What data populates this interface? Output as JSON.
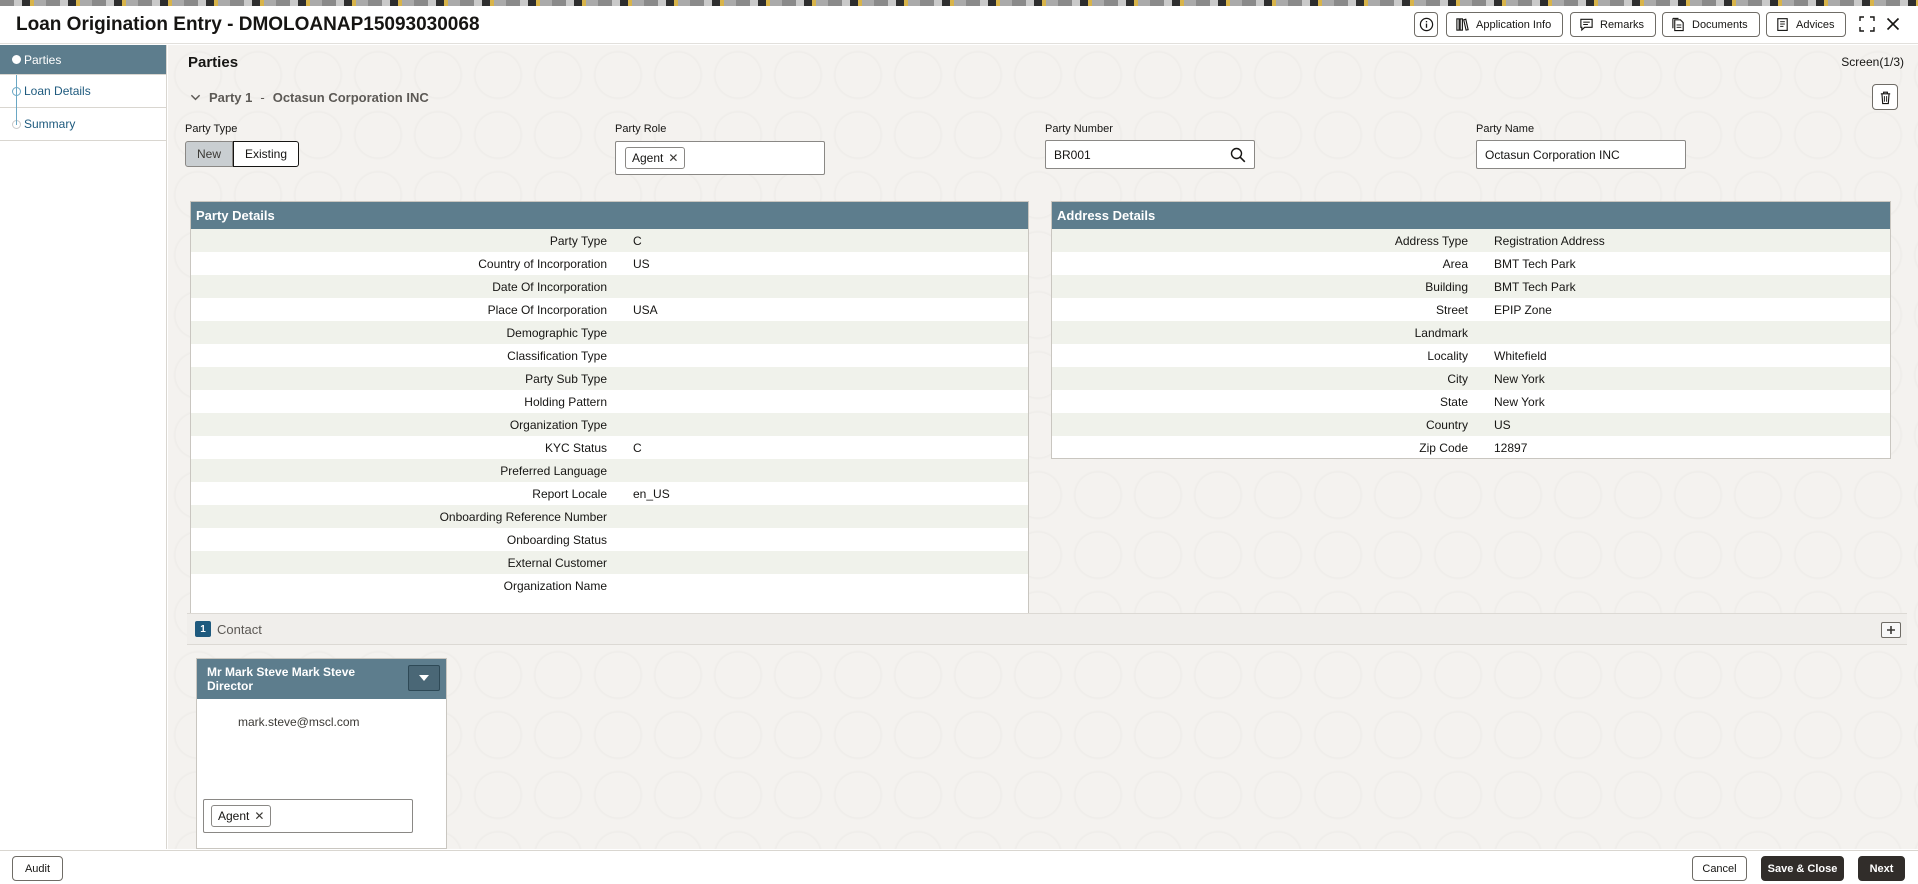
{
  "header": {
    "title": "Loan Origination Entry - DMOLOANAP15093030068",
    "buttons": {
      "application_info": "Application Info",
      "remarks": "Remarks",
      "documents": "Documents",
      "advices": "Advices"
    }
  },
  "sidebar": {
    "items": [
      {
        "label": "Parties",
        "state": "active"
      },
      {
        "label": "Loan Details",
        "state": "current"
      },
      {
        "label": "Summary",
        "state": "pending"
      }
    ]
  },
  "main": {
    "title": "Parties",
    "screen": "Screen(1/3)",
    "party_header": {
      "prefix": "Party 1",
      "separator": "-",
      "name": "Octasun Corporation INC"
    },
    "fields": {
      "party_type_label": "Party Type",
      "party_type_options": [
        "New",
        "Existing"
      ],
      "party_role_label": "Party Role",
      "party_role_chip": "Agent",
      "party_number_label": "Party Number",
      "party_number_value": "BR001",
      "party_name_label": "Party Name",
      "party_name_value": "Octasun Corporation INC"
    }
  },
  "party_details": {
    "title": "Party Details",
    "rows": [
      {
        "label": "Party Type",
        "value": "C"
      },
      {
        "label": "Country of Incorporation",
        "value": "US"
      },
      {
        "label": "Date Of Incorporation",
        "value": ""
      },
      {
        "label": "Place Of Incorporation",
        "value": "USA"
      },
      {
        "label": "Demographic Type",
        "value": ""
      },
      {
        "label": "Classification Type",
        "value": ""
      },
      {
        "label": "Party Sub Type",
        "value": ""
      },
      {
        "label": "Holding Pattern",
        "value": ""
      },
      {
        "label": "Organization Type",
        "value": ""
      },
      {
        "label": "KYC Status",
        "value": "C"
      },
      {
        "label": "Preferred Language",
        "value": ""
      },
      {
        "label": "Report Locale",
        "value": "en_US"
      },
      {
        "label": "Onboarding Reference Number",
        "value": ""
      },
      {
        "label": "Onboarding Status",
        "value": ""
      },
      {
        "label": "External Customer",
        "value": ""
      },
      {
        "label": "Organization Name",
        "value": ""
      }
    ]
  },
  "address_details": {
    "title": "Address Details",
    "rows": [
      {
        "label": "Address Type",
        "value": "Registration Address"
      },
      {
        "label": "Area",
        "value": "BMT Tech Park"
      },
      {
        "label": "Building",
        "value": "BMT Tech Park"
      },
      {
        "label": "Street",
        "value": "EPIP Zone"
      },
      {
        "label": "Landmark",
        "value": ""
      },
      {
        "label": "Locality",
        "value": "Whitefield"
      },
      {
        "label": "City",
        "value": "New York"
      },
      {
        "label": "State",
        "value": "New York"
      },
      {
        "label": "Country",
        "value": "US"
      },
      {
        "label": "Zip Code",
        "value": "12897"
      }
    ]
  },
  "contact": {
    "count": "1",
    "label": "Contact",
    "card": {
      "name": "Mr  Mark Steve  Mark Steve",
      "designation": "Director",
      "email": "mark.steve@mscl.com",
      "role_chip": "Agent"
    }
  },
  "footer": {
    "audit": "Audit",
    "cancel": "Cancel",
    "save_close": "Save & Close",
    "next": "Next"
  },
  "colors": {
    "panel_header": "#5d7d8d",
    "primary_dark": "#312d2a",
    "link": "#1e5a7e"
  }
}
